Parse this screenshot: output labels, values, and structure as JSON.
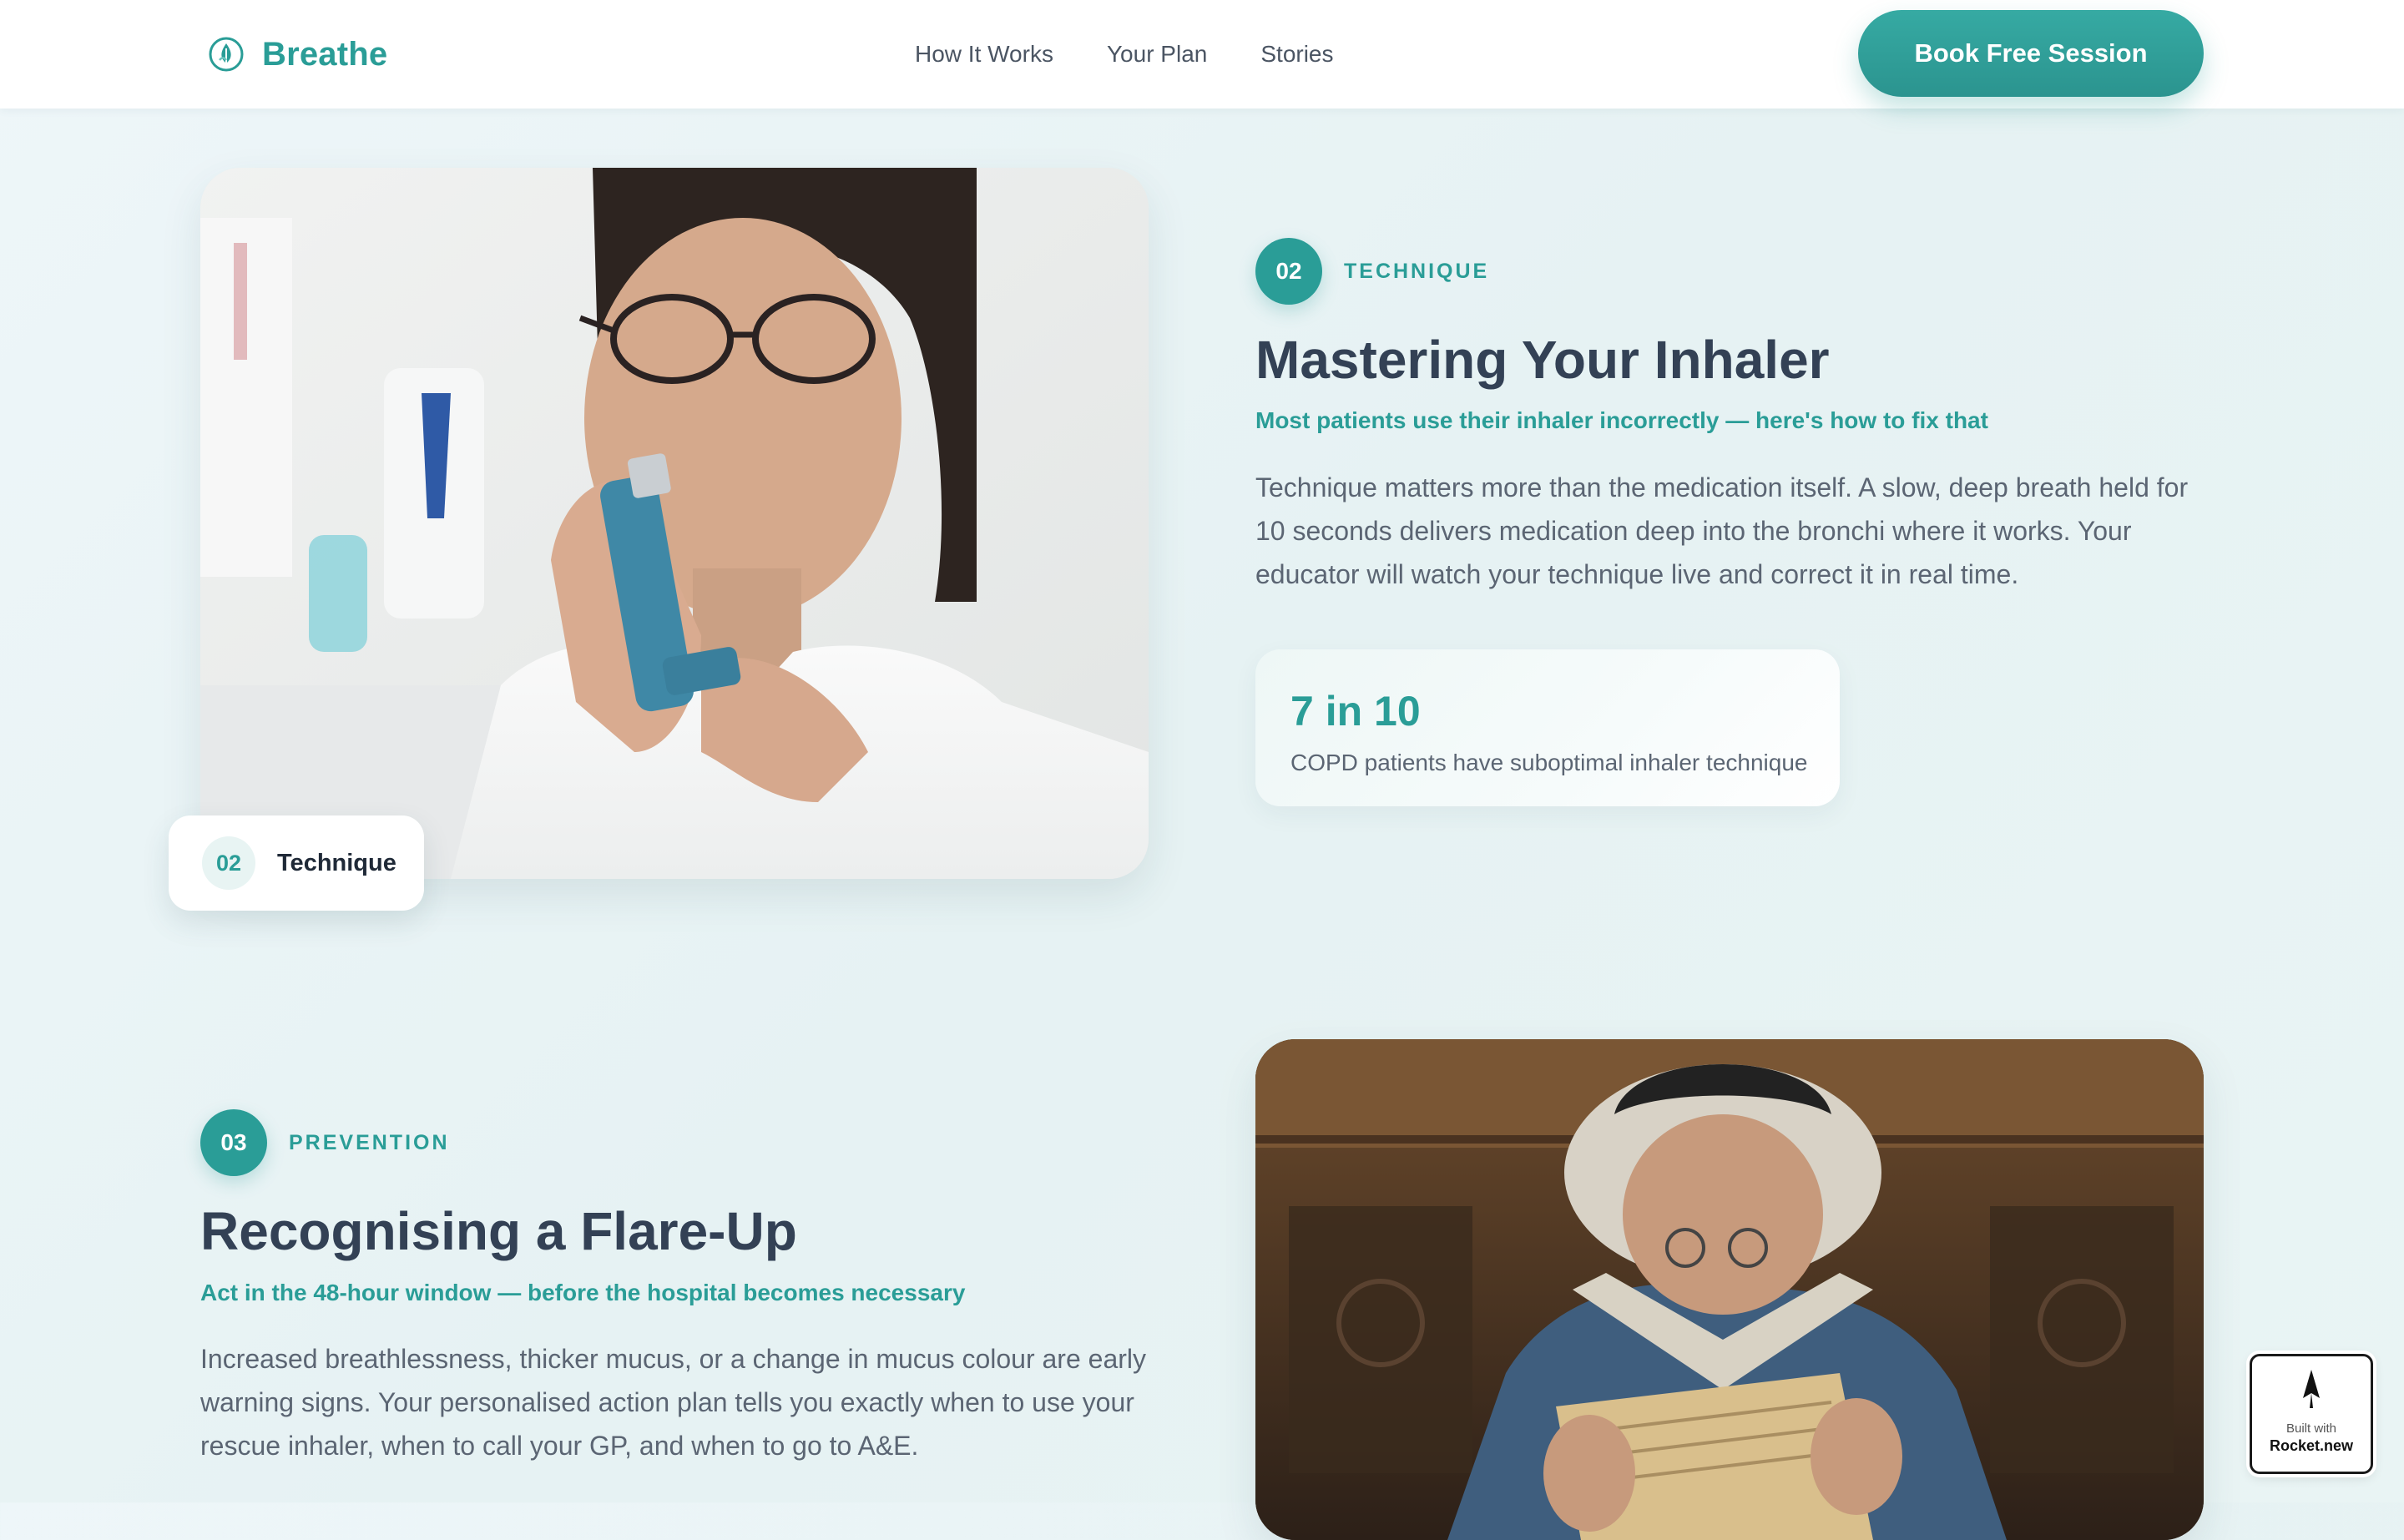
{
  "nav": {
    "brand": "Breathe",
    "links": [
      "How It Works",
      "Your Plan",
      "Stories"
    ],
    "cta": "Book Free Session"
  },
  "technique": {
    "step": "02",
    "tag": "TECHNIQUE",
    "title": "Mastering Your Inhaler",
    "subtitle": "Most patients use their inhaler incorrectly — here's how to fix that",
    "body": "Technique matters more than the medication itself. A slow, deep breath held for 10 seconds delivers medication deep into the bronchi where it works. Your educator will watch your technique live and correct it in real time.",
    "stat_value": "7 in 10",
    "stat_label": "COPD patients have suboptimal inhaler technique",
    "badge_num": "02",
    "badge_label": "Technique"
  },
  "prevention": {
    "step": "03",
    "tag": "PREVENTION",
    "title": "Recognising a Flare-Up",
    "subtitle": "Act in the 48-hour window — before the hospital becomes necessary",
    "body": "Increased breathlessness, thicker mucus, or a change in mucus colour are early warning signs. Your personalised action plan tells you exactly when to use your rescue inhaler, when to call your GP, and when to go to A&E."
  },
  "rocket_badge": {
    "small": "Built with",
    "name": "Rocket.new"
  },
  "colors": {
    "accent": "#2a9d97",
    "heading": "#334155",
    "body": "#5b6573",
    "background": "#e8f3f4"
  },
  "icons": {
    "brand": "leaf-drop-icon",
    "rocket": "rocket-icon"
  }
}
